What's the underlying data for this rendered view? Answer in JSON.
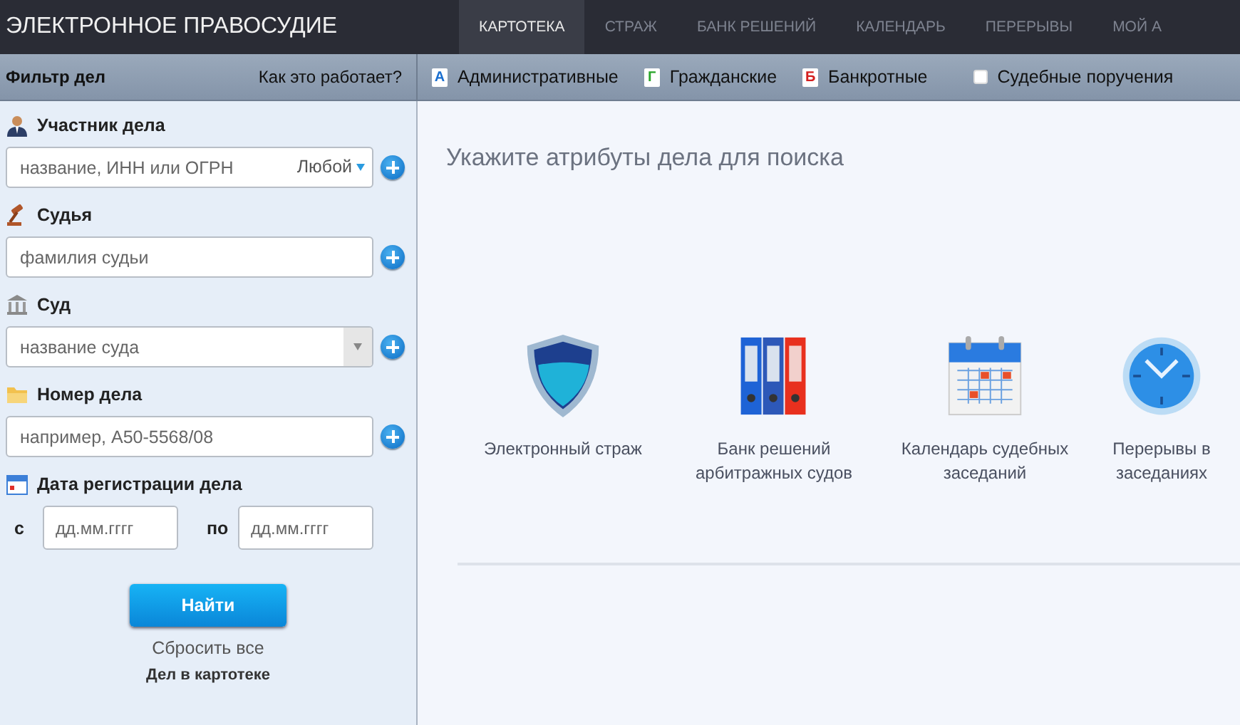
{
  "header": {
    "title": "ЭЛЕКТРОННОЕ ПРАВОСУДИЕ"
  },
  "nav_tabs": [
    {
      "label": "КАРТОТЕКА",
      "selected": true
    },
    {
      "label": "СТРАЖ",
      "selected": false
    },
    {
      "label": "БАНК РЕШЕНИЙ",
      "selected": false
    },
    {
      "label": "КАЛЕНДАРЬ",
      "selected": false
    },
    {
      "label": "ПЕРЕРЫВЫ",
      "selected": false
    },
    {
      "label": "МОЙ А",
      "selected": false
    }
  ],
  "toolbar": {
    "filter_title": "Фильтр дел",
    "help_link": "Как это работает?",
    "case_types": [
      {
        "letter": "А",
        "label": "Административные",
        "color": "#1a6fd0"
      },
      {
        "letter": "Г",
        "label": "Гражданские",
        "color": "#2aa52a"
      },
      {
        "letter": "Б",
        "label": "Банкротные",
        "color": "#d42020"
      }
    ],
    "court_orders": {
      "label": "Судебные поручения",
      "checked": false
    }
  },
  "filter": {
    "sections": [
      {
        "kind": "participant",
        "label": "Участник дела",
        "placeholder": "название, ИНН или ОГРН",
        "role": "Любой"
      },
      {
        "kind": "judge",
        "label": "Судья",
        "placeholder": "фамилия судьи"
      },
      {
        "kind": "court",
        "label": "Суд",
        "placeholder": "название суда"
      },
      {
        "kind": "number",
        "label": "Номер дела",
        "placeholder": "например, А50-5568/08"
      }
    ],
    "date": {
      "label": "Дата регистрации дела",
      "from_label": "с",
      "from_placeholder": "дд.мм.гггг",
      "to_label": "по",
      "to_placeholder": "дд.мм.гггг"
    },
    "search_button": "Найти",
    "reset_link": "Сбросить все",
    "footer_text": "Дел в картотеке"
  },
  "main": {
    "prompt": "Укажите атрибуты дела для поиска",
    "services": [
      {
        "kind": "shield",
        "label": "Электронный страж"
      },
      {
        "kind": "binders",
        "label": "Банк решений арбитражных судов"
      },
      {
        "kind": "calendar",
        "label": "Календарь судебных заседаний"
      },
      {
        "kind": "clock",
        "label": "Перерывы в заседаниях"
      }
    ]
  }
}
